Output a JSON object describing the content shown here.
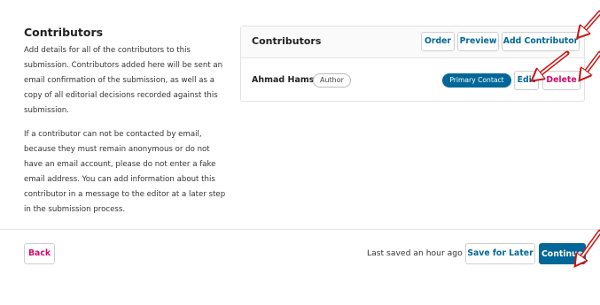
{
  "intro": {
    "title": "Contributors",
    "paragraph1": "Add details for all of the contributors to this submission. Contributors added here will be sent an email confirmation of the submission, as well as a copy of all editorial decisions recorded against this submission.",
    "paragraph2": "If a contributor can not be contacted by email, because they must remain anonymous or do not have an email account, please do not enter a fake email address. You can add information about this contributor in a message to the editor at a later step in the submission process."
  },
  "panel": {
    "title": "Contributors",
    "order_label": "Order",
    "preview_label": "Preview",
    "add_label": "Add Contributor",
    "contributor": {
      "name": "Ahmad Hamsa",
      "role": "Author",
      "primary_label": "Primary Contact",
      "edit_label": "Edit",
      "delete_label": "Delete"
    }
  },
  "footer": {
    "back_label": "Back",
    "saved_text": "Last saved an hour ago",
    "save_later_label": "Save for Later",
    "continue_label": "Continue"
  },
  "colors": {
    "accent": "#006798",
    "danger": "#d00a6c",
    "annotation_arrow": "#cc1111"
  }
}
